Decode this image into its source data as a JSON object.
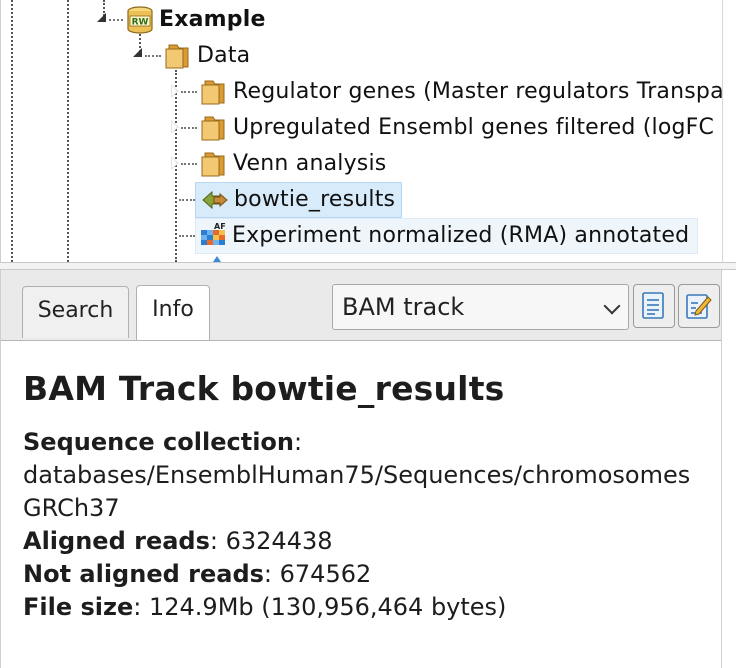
{
  "tree": {
    "nodes": [
      {
        "label": "Example",
        "icon": "database-rw-icon"
      },
      {
        "label": "Data",
        "icon": "folder-icon"
      },
      {
        "label": "Regulator genes (Master regulators Transpa",
        "icon": "folder-icon"
      },
      {
        "label": "Upregulated Ensembl genes filtered (logFC",
        "icon": "folder-icon"
      },
      {
        "label": "Venn analysis",
        "icon": "folder-icon"
      },
      {
        "label": "bowtie_results",
        "icon": "bam-track-icon"
      },
      {
        "label": "Experiment normalized (RMA) annotated",
        "icon": "table-icon"
      }
    ]
  },
  "tabs": [
    {
      "label": "Search"
    },
    {
      "label": "Info"
    }
  ],
  "view_select": {
    "value": "BAM track"
  },
  "toolbar": {
    "doc_icon": "document-icon",
    "edit_icon": "edit-icon"
  },
  "info": {
    "title": "BAM Track bowtie_results",
    "sequence_collection_label": "Sequence collection",
    "sequence_collection_value_1": "databases/EnsemblHuman75/Sequences/chromosomes",
    "sequence_collection_value_2": "GRCh37",
    "aligned_reads_label": "Aligned reads",
    "aligned_reads_value": "6324438",
    "not_aligned_reads_label": "Not aligned reads",
    "not_aligned_reads_value": "674562",
    "file_size_label": "File size",
    "file_size_value": "124.9Mb (130,956,464 bytes)",
    "separator": ":"
  },
  "colors": {
    "selection": "#d7ebfa",
    "folder": "#e3b45a",
    "tab_bar": "#eaeaea"
  }
}
